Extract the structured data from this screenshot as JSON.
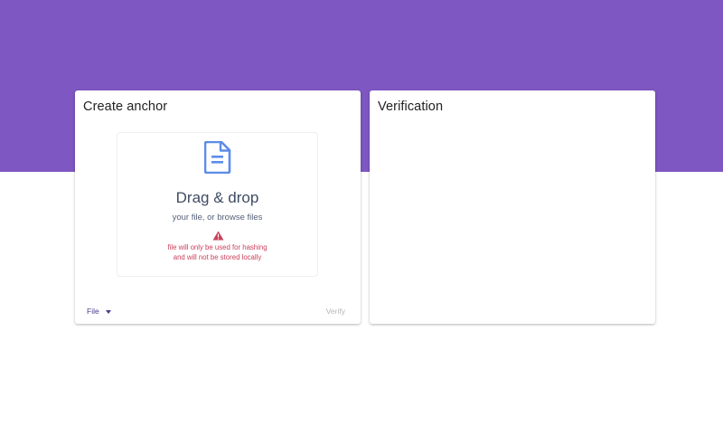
{
  "colors": {
    "hero_background": "#7e57c2",
    "card_background": "#ffffff",
    "doc_icon": "#5b8de8",
    "warning": "#c9405b",
    "dropdown_text": "#4a3d8f",
    "disabled_text": "#b8b8b8"
  },
  "create_card": {
    "title": "Create anchor",
    "dropzone": {
      "icon": "document-icon",
      "title": "Drag & drop",
      "subtitle": "your file, or browse files",
      "warning_icon": "warning-icon",
      "warning_line1": "file will only be used for hashing",
      "warning_line2": "and will not be stored locally"
    },
    "type_select": {
      "value": "File",
      "icon": "caret-down-icon"
    },
    "verify_label": "Verify"
  },
  "verification_card": {
    "title": "Verification"
  }
}
